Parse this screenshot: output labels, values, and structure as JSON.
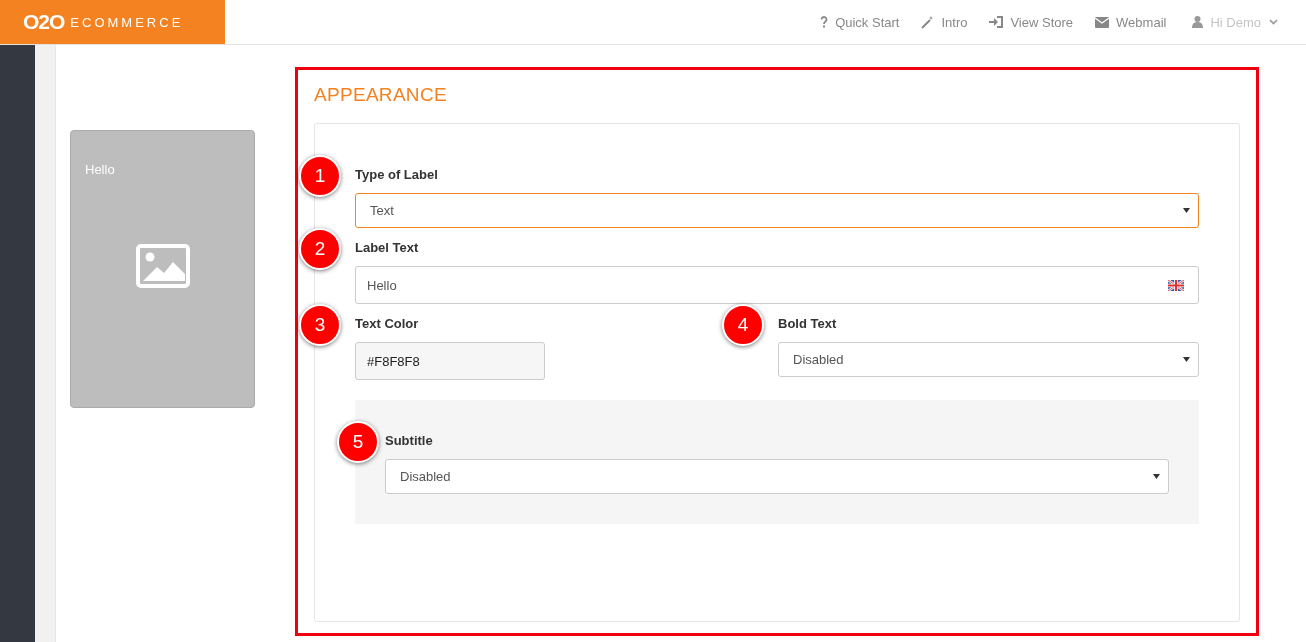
{
  "header": {
    "logo": {
      "mark": "O2O",
      "word": "ECOMMERCE"
    },
    "nav": [
      {
        "label": "Quick Start",
        "dropdown": false
      },
      {
        "label": "Intro",
        "dropdown": false
      },
      {
        "label": "View Store",
        "dropdown": false
      },
      {
        "label": "Webmail",
        "dropdown": false
      },
      {
        "label": "Hi Demo",
        "dropdown": true
      }
    ]
  },
  "preview": {
    "text": "Hello"
  },
  "section": {
    "title": "APPEARANCE",
    "rows": [
      {
        "kind": "single",
        "fields": [
          {
            "badge": "1",
            "label": "Type of Label",
            "kind": "select",
            "value": "Text",
            "focused": true
          }
        ]
      },
      {
        "kind": "single",
        "fields": [
          {
            "badge": "2",
            "label": "Label Text",
            "kind": "text",
            "value": "Hello",
            "language_flag": true
          }
        ]
      },
      {
        "kind": "pair",
        "fields": [
          {
            "badge": "3",
            "label": "Text Color",
            "kind": "color",
            "value": "#F8F8F8"
          },
          {
            "badge": "4",
            "label": "Bold Text",
            "kind": "select",
            "value": "Disabled",
            "focused": false
          }
        ]
      },
      {
        "kind": "subpanel",
        "fields": [
          {
            "badge": "5",
            "label": "Subtitle",
            "kind": "select",
            "value": "Disabled",
            "focused": false
          }
        ]
      }
    ]
  }
}
